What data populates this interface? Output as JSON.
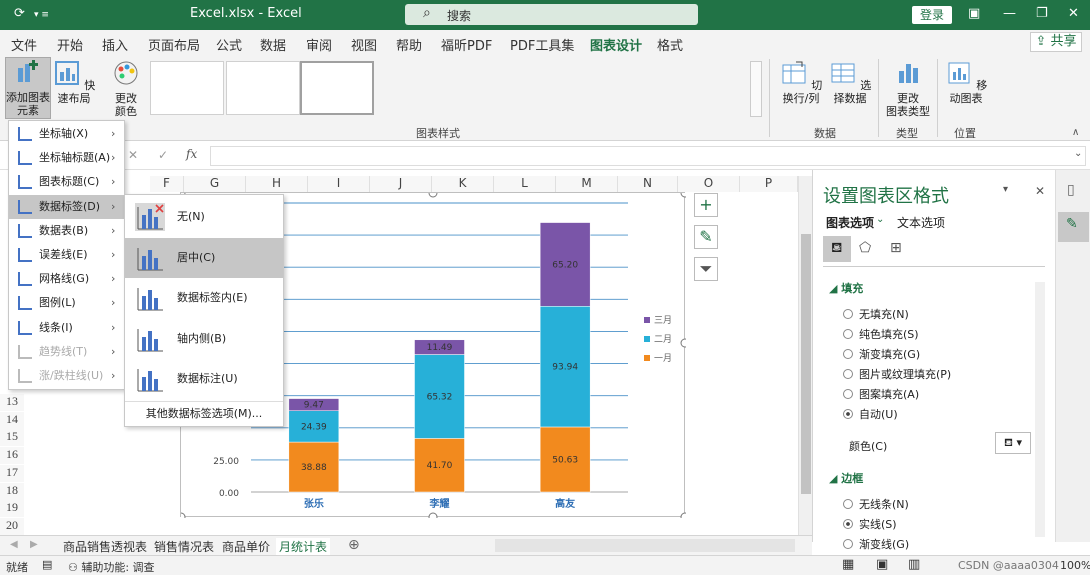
{
  "titlebar": {
    "autosave": "⟳",
    "title": "Excel.xlsx  -  Excel",
    "search": "搜索",
    "login": "登录",
    "win_min": "—",
    "win_restore": "❐",
    "win_close": "✕",
    "ribbon_toggle": "▣"
  },
  "tabs": [
    "文件",
    "开始",
    "插入",
    "页面布局",
    "公式",
    "数据",
    "审阅",
    "视图",
    "帮助",
    "福昕PDF",
    "PDF工具集",
    "图表设计",
    "格式"
  ],
  "active_tab": "图表设计",
  "share": "共享",
  "ribbon": {
    "add_element": "添加图表\n元素",
    "quick_layout": "快速布局",
    "change_colors": "更改\n颜色",
    "styles_group": "图表样式",
    "switch_rowcol": "切换行/列",
    "select_data": "选择数据",
    "data_group": "数据",
    "change_type": "更改\n图表类型",
    "type_group": "类型",
    "move_chart": "移动图表",
    "location_group": "位置"
  },
  "formula": {
    "fx": "fx",
    "x": "✕",
    "check": "✓"
  },
  "columns": [
    "F",
    "G",
    "H",
    "I",
    "J",
    "K",
    "L",
    "M",
    "N",
    "O",
    "P"
  ],
  "rows": [
    "13",
    "14",
    "15",
    "16",
    "17",
    "18",
    "19",
    "20"
  ],
  "menu1": [
    {
      "label": "坐标轴(X)",
      "disabled": false
    },
    {
      "label": "坐标轴标题(A)",
      "disabled": false
    },
    {
      "label": "图表标题(C)",
      "disabled": false
    },
    {
      "label": "数据标签(D)",
      "disabled": false
    },
    {
      "label": "数据表(B)",
      "disabled": false
    },
    {
      "label": "误差线(E)",
      "disabled": false
    },
    {
      "label": "网格线(G)",
      "disabled": false
    },
    {
      "label": "图例(L)",
      "disabled": false
    },
    {
      "label": "线条(I)",
      "disabled": false
    },
    {
      "label": "趋势线(T)",
      "disabled": true
    },
    {
      "label": "涨/跌柱线(U)",
      "disabled": true
    }
  ],
  "menu2": [
    "无(N)",
    "居中(C)",
    "数据标签内(E)",
    "轴内侧(B)",
    "数据标注(U)"
  ],
  "menu2_more": "其他数据标签选项(M)...",
  "chart_data": {
    "type": "bar",
    "stacked": true,
    "categories": [
      "张乐",
      "李耀",
      "高友"
    ],
    "series": [
      {
        "name": "一月",
        "values": [
          38.88,
          41.7,
          50.63
        ],
        "color": "#f28a1e"
      },
      {
        "name": "二月",
        "values": [
          24.39,
          65.32,
          93.94
        ],
        "color": "#27b0d8"
      },
      {
        "name": "三月",
        "values": [
          9.47,
          11.49,
          65.2
        ],
        "color": "#7a55a8"
      }
    ],
    "y_ticks": [
      "0.00",
      "25.00"
    ],
    "ylim": [
      0,
      225
    ],
    "legend_position": "right",
    "grid": true
  },
  "pane": {
    "title": "设置图表区格式",
    "tab_chart": "图表选项",
    "tab_text": "文本选项",
    "fill_section": "填充",
    "fill_options": [
      "无填充(N)",
      "纯色填充(S)",
      "渐变填充(G)",
      "图片或纹理填充(P)",
      "图案填充(A)",
      "自动(U)"
    ],
    "fill_selected": 5,
    "color_label": "颜色(C)",
    "border_section": "边框",
    "border_options": [
      "无线条(N)",
      "实线(S)",
      "渐变线(G)"
    ],
    "border_selected": 1
  },
  "sheet_tabs": [
    "商品销售透视表",
    "销售情况表",
    "商品单价",
    "月统计表"
  ],
  "active_sheet": "月统计表",
  "status": {
    "ready": "就绪",
    "accessibility": "辅助功能: 调查",
    "zoom": "100%",
    "watermark": "CSDN @aaaa0304"
  }
}
